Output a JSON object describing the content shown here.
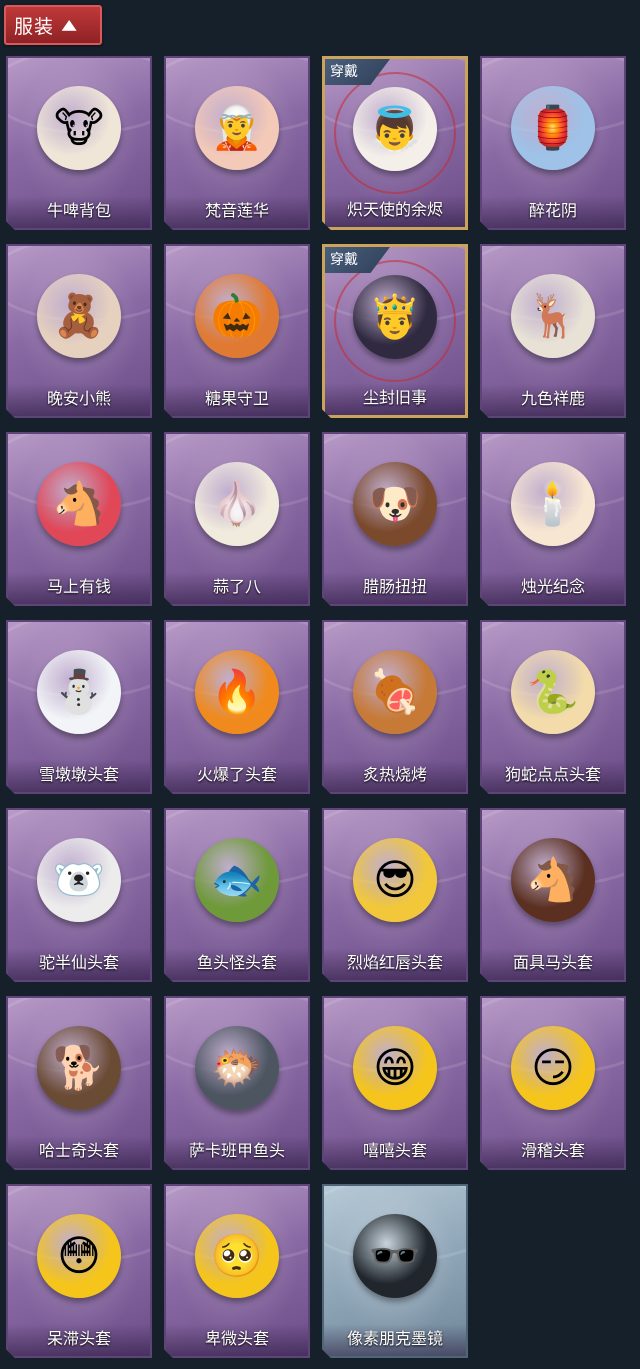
{
  "header": {
    "title": "服装",
    "toggle_icon": "chevron-up-icon"
  },
  "worn_label": "穿戴",
  "items": [
    {
      "label": "牛啤背包",
      "icon": "🐮",
      "color": "#f0e6d8",
      "worn": false,
      "style": "purple"
    },
    {
      "label": "梵音莲华",
      "icon": "🧝",
      "color": "#f3c9b8",
      "worn": false,
      "style": "purple"
    },
    {
      "label": "炽天使的余烬",
      "icon": "👼",
      "color": "#f4efe9",
      "worn": true,
      "style": "purple"
    },
    {
      "label": "醉花阴",
      "icon": "🏮",
      "color": "#9fc2e8",
      "worn": false,
      "style": "purple"
    },
    {
      "label": "晚安小熊",
      "icon": "🧸",
      "color": "#e6d1bf",
      "worn": false,
      "style": "purple"
    },
    {
      "label": "糖果守卫",
      "icon": "🎃",
      "color": "#e07a32",
      "worn": false,
      "style": "purple"
    },
    {
      "label": "尘封旧事",
      "icon": "🤴",
      "color": "#2f2a3f",
      "worn": true,
      "style": "purple"
    },
    {
      "label": "九色祥鹿",
      "icon": "🦌",
      "color": "#e8e2d6",
      "worn": false,
      "style": "purple"
    },
    {
      "label": "马上有钱",
      "icon": "🐴",
      "color": "#e04858",
      "worn": false,
      "style": "purple"
    },
    {
      "label": "蒜了八",
      "icon": "🧄",
      "color": "#f1ebde",
      "worn": false,
      "style": "purple"
    },
    {
      "label": "腊肠扭扭",
      "icon": "🐶",
      "color": "#7b4a2c",
      "worn": false,
      "style": "purple"
    },
    {
      "label": "烛光纪念",
      "icon": "🕯️",
      "color": "#f7e6d2",
      "worn": false,
      "style": "purple"
    },
    {
      "label": "雪墩墩头套",
      "icon": "⛄",
      "color": "#f2f4f8",
      "worn": false,
      "style": "purple"
    },
    {
      "label": "火爆了头套",
      "icon": "🔥",
      "color": "#f08a1c",
      "worn": false,
      "style": "purple"
    },
    {
      "label": "炙热烧烤",
      "icon": "🍖",
      "color": "#c77a36",
      "worn": false,
      "style": "purple"
    },
    {
      "label": "狗蛇点点头套",
      "icon": "🐍",
      "color": "#f3dcaa",
      "worn": false,
      "style": "purple"
    },
    {
      "label": "驼半仙头套",
      "icon": "🐻‍❄️",
      "color": "#ececec",
      "worn": false,
      "style": "purple"
    },
    {
      "label": "鱼头怪头套",
      "icon": "🐟",
      "color": "#6f9a3a",
      "worn": false,
      "style": "purple"
    },
    {
      "label": "烈焰红唇头套",
      "icon": "😎",
      "color": "#f2c83a",
      "worn": false,
      "style": "purple"
    },
    {
      "label": "面具马头套",
      "icon": "🐴",
      "color": "#5b3020",
      "worn": false,
      "style": "purple"
    },
    {
      "label": "哈士奇头套",
      "icon": "🐕",
      "color": "#6a4b34",
      "worn": false,
      "style": "purple"
    },
    {
      "label": "萨卡班甲鱼头",
      "icon": "🐡",
      "color": "#4c5560",
      "worn": false,
      "style": "purple"
    },
    {
      "label": "嘻嘻头套",
      "icon": "😁",
      "color": "#f5c51c",
      "worn": false,
      "style": "purple"
    },
    {
      "label": "滑稽头套",
      "icon": "😏",
      "color": "#f5c51c",
      "worn": false,
      "style": "purple"
    },
    {
      "label": "呆滞头套",
      "icon": "😳",
      "color": "#f5c51c",
      "worn": false,
      "style": "purple"
    },
    {
      "label": "卑微头套",
      "icon": "🥺",
      "color": "#f5c51c",
      "worn": false,
      "style": "purple"
    },
    {
      "label": "像素朋克墨镜",
      "icon": "🕶️",
      "color": "#20262c",
      "worn": false,
      "style": "blue"
    }
  ]
}
